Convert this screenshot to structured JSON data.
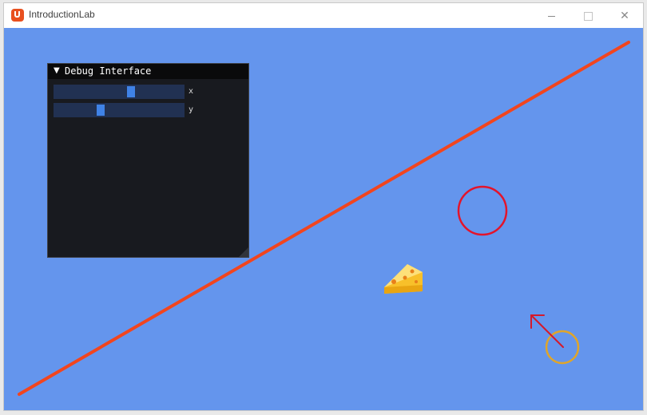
{
  "window": {
    "title": "IntroductionLab",
    "controls": {
      "minimize": "minimize",
      "maximize": "maximize",
      "close": "✕"
    }
  },
  "game": {
    "background_color": "#6495ed",
    "line_color": "#f2451e",
    "target_circle_color": "#e3142b",
    "player_circle_color": "#e0a52a",
    "arrow_color": "#d41a2c",
    "sprite": "cheese-icon"
  },
  "debug_panel": {
    "title": "Debug Interface",
    "collapse_icon": "▼",
    "sliders": [
      {
        "label": "x",
        "value_fraction": 0.6
      },
      {
        "label": "y",
        "value_fraction": 0.35
      }
    ]
  }
}
